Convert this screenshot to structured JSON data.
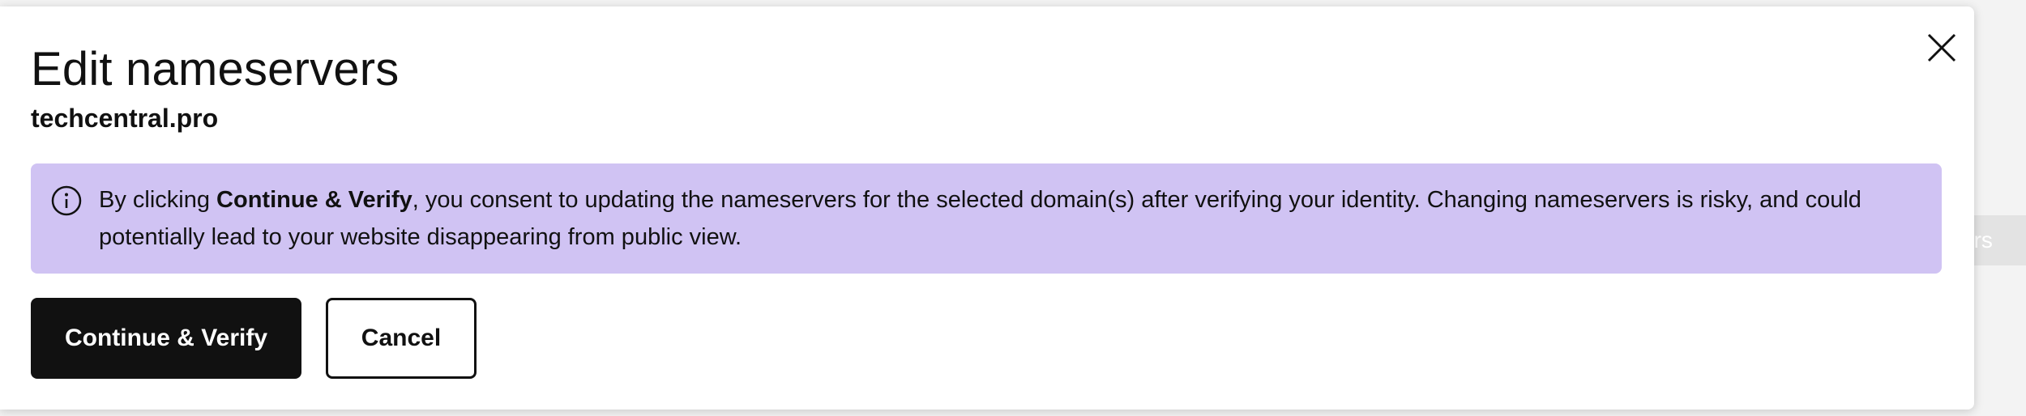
{
  "background": {
    "ghost_button_label": "ers"
  },
  "dialog": {
    "title": "Edit nameservers",
    "domain": "techcentral.pro",
    "close_icon": "close-icon",
    "alert": {
      "icon": "info-icon",
      "text_prefix": "By clicking ",
      "text_bold": "Continue & Verify",
      "text_suffix": ", you consent to updating the nameservers for the selected domain(s) after verifying your identity. Changing nameservers is risky, and could potentially lead to your website disappearing from public view.",
      "background_color": "#d0c3f3"
    },
    "buttons": {
      "continue_label": "Continue & Verify",
      "cancel_label": "Cancel"
    }
  }
}
